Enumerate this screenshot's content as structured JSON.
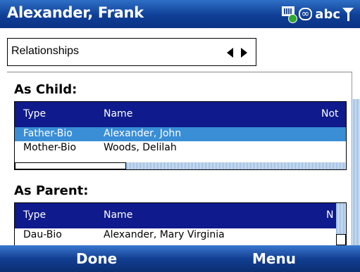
{
  "title": "Alexander, Frank",
  "status": {
    "input_mode": "abc"
  },
  "picker": {
    "value": "Relationships"
  },
  "as_child": {
    "title": "As Child:",
    "columns": [
      "Type",
      "Name",
      "Not"
    ],
    "rows": [
      {
        "type": "Father-Bio",
        "name": "Alexander, John",
        "selected": true
      },
      {
        "type": "Mother-Bio",
        "name": "Woods, Delilah",
        "selected": false
      }
    ]
  },
  "as_parent": {
    "title": "As Parent:",
    "columns": [
      "Type",
      "Name",
      "N"
    ],
    "rows": [
      {
        "type": "Dau-Bio",
        "name": "Alexander, Mary Virginia",
        "selected": false
      }
    ]
  },
  "softkeys": {
    "left": "Done",
    "right": "Menu"
  },
  "colors": {
    "title_bar": "#0f3f96",
    "grid_header": "#0f1a8c",
    "selection": "#3a8ed6"
  },
  "icons": [
    "keyboard-icon",
    "input-mode-icon",
    "signal-icon",
    "arrow-left-icon",
    "arrow-right-icon"
  ]
}
